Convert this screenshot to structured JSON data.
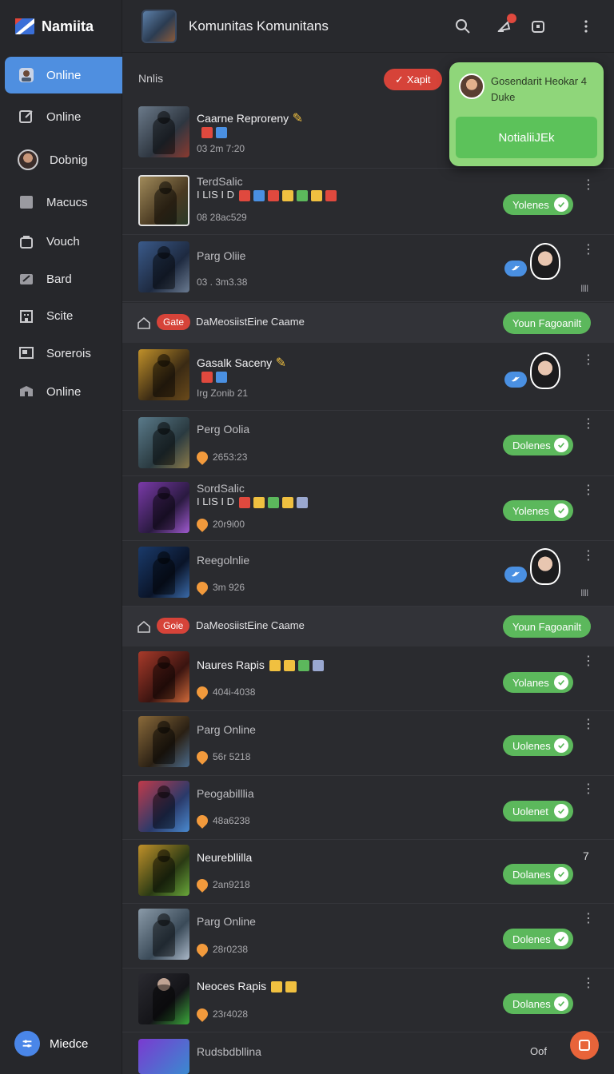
{
  "brand": {
    "name": "Namiita"
  },
  "sidebar": {
    "items": [
      {
        "label": "Online",
        "icon": "avatar-icon",
        "active": true
      },
      {
        "label": "Online",
        "icon": "edit-icon"
      },
      {
        "label": "Dobnig",
        "icon": "profile-avatar"
      },
      {
        "label": "Macucs",
        "icon": "square-icon"
      },
      {
        "label": "Vouch",
        "icon": "bag-icon"
      },
      {
        "label": "Bard",
        "icon": "note-icon"
      },
      {
        "label": "Scite",
        "icon": "building-icon"
      },
      {
        "label": "Sorerois",
        "icon": "screen-icon"
      },
      {
        "label": "Online",
        "icon": "box-icon"
      }
    ],
    "footer_label": "Miedce"
  },
  "header": {
    "title": "Komunitas Komunitans"
  },
  "toolbar": {
    "label": "Nnlis",
    "chip": "Xapit"
  },
  "popup": {
    "text_line1": "Gosendarit Heokar 4",
    "text_line2": "Duke",
    "button": "NotialiiJEk"
  },
  "rows": [
    {
      "title": "Caarne Reproreny",
      "meta": "03 2m 7:20",
      "badge": "",
      "status": "none"
    },
    {
      "title": "TerdSalic",
      "subtitle": "I LIS I D",
      "meta": "08 28ac529",
      "status": "pill",
      "pill": "Yolenes"
    },
    {
      "title": "Parg Oliie",
      "meta": "03 . 3m3.38",
      "status": "person"
    },
    {
      "title": "Gasalk Saceny",
      "meta": "Irg Zonib 21",
      "status": "person"
    },
    {
      "title": "Perg Oolia",
      "meta": "2653:23",
      "status": "pill",
      "pill": "Dolenes"
    },
    {
      "title": "SordSalic",
      "subtitle": "I LIS I D",
      "meta": "20r9i00",
      "status": "pill",
      "pill": "Yolenes"
    },
    {
      "title": "Reegolnlie",
      "meta": "3m 926",
      "status": "person"
    },
    {
      "title": "Naures Rapis",
      "meta": "404i-4038",
      "status": "pill",
      "pill": "Yolanes"
    },
    {
      "title": "Parg Online",
      "meta": "56r 5218",
      "status": "pill",
      "pill": "Uolenes"
    },
    {
      "title": "Peogabilllia",
      "meta": "48a6238",
      "status": "pill",
      "pill": "Uolenet"
    },
    {
      "title": "Neurebllilla",
      "meta": "2an9218",
      "status": "pill",
      "pill": "Dolanes"
    },
    {
      "title": "Parg Online",
      "meta": "28r0238",
      "status": "pill",
      "pill": "Dolenes"
    },
    {
      "title": "Neoces Rapis",
      "meta": "23r4028",
      "status": "pill",
      "pill": "Dolanes"
    },
    {
      "title": "Rudsbdbllina",
      "meta": "",
      "status": "none"
    }
  ],
  "sections": [
    {
      "chip": "Gate",
      "label": "DaMeosiistEine Caame",
      "button": "Youn Fagoanilt"
    },
    {
      "chip": "Goie",
      "label": "DaMeosiistEine Caame",
      "button": "Youn Fagoanilt"
    }
  ],
  "misc": {
    "side_number": "7",
    "bottom_label": "Oof",
    "bars": "IIII"
  }
}
